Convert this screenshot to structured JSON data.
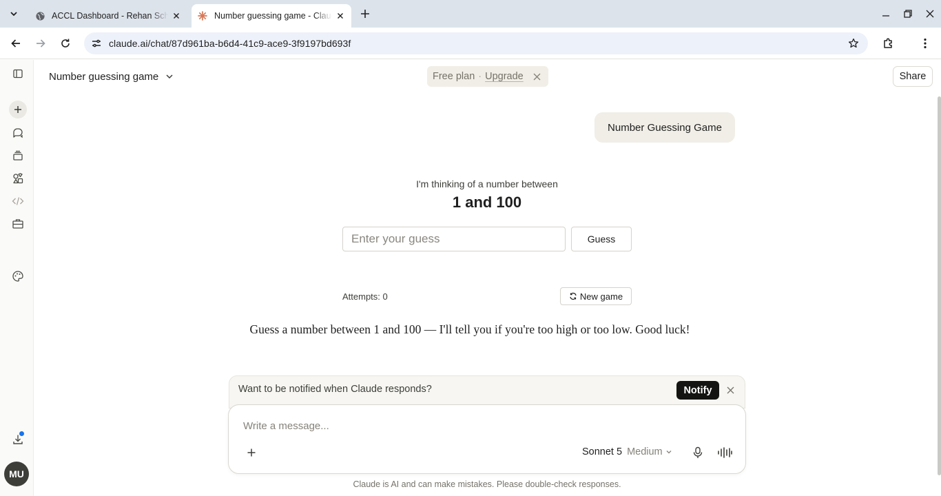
{
  "browser": {
    "tabs": [
      {
        "title": "ACCL Dashboard - Rehan Scho",
        "active": false
      },
      {
        "title": "Number guessing game - Claude",
        "active": true
      }
    ],
    "url": "claude.ai/chat/87d961ba-b6d4-41c9-ace9-3f9197bd693f"
  },
  "header": {
    "chat_title": "Number guessing game",
    "plan_label": "Free plan",
    "plan_separator": "·",
    "upgrade_label": "Upgrade",
    "share_label": "Share"
  },
  "sidebar": {
    "avatar_initials": "MU",
    "icons": [
      "sidebar-toggle-icon",
      "new-chat-icon",
      "chats-icon",
      "projects-icon",
      "artifacts-icon",
      "code-icon",
      "briefcase-icon",
      "palette-icon",
      "download-icon"
    ]
  },
  "conversation": {
    "user_message": "Number Guessing Game"
  },
  "game": {
    "intro": "I'm thinking of a number between",
    "range": "1 and 100",
    "input_placeholder": "Enter your guess",
    "guess_label": "Guess",
    "attempts_text": "Attempts: 0",
    "new_game_label": "New game",
    "hint": "Guess a number between 1 and 100 — I'll tell you if you're too high or too low. Good luck!"
  },
  "notify": {
    "text": "Want to be notified when Claude responds?",
    "button_label": "Notify"
  },
  "composer": {
    "placeholder": "Write a message...",
    "model": "Sonnet 5",
    "effort": "Medium"
  },
  "footer": {
    "disclaimer": "Claude is AI and can make mistakes. Please double-check responses."
  },
  "colors": {
    "tabbar": "#dde3ea",
    "omnibox": "#edf2fa",
    "notify_button": "#141413",
    "claude_accent": "#d97757",
    "notification_dot": "#1a73e8"
  }
}
